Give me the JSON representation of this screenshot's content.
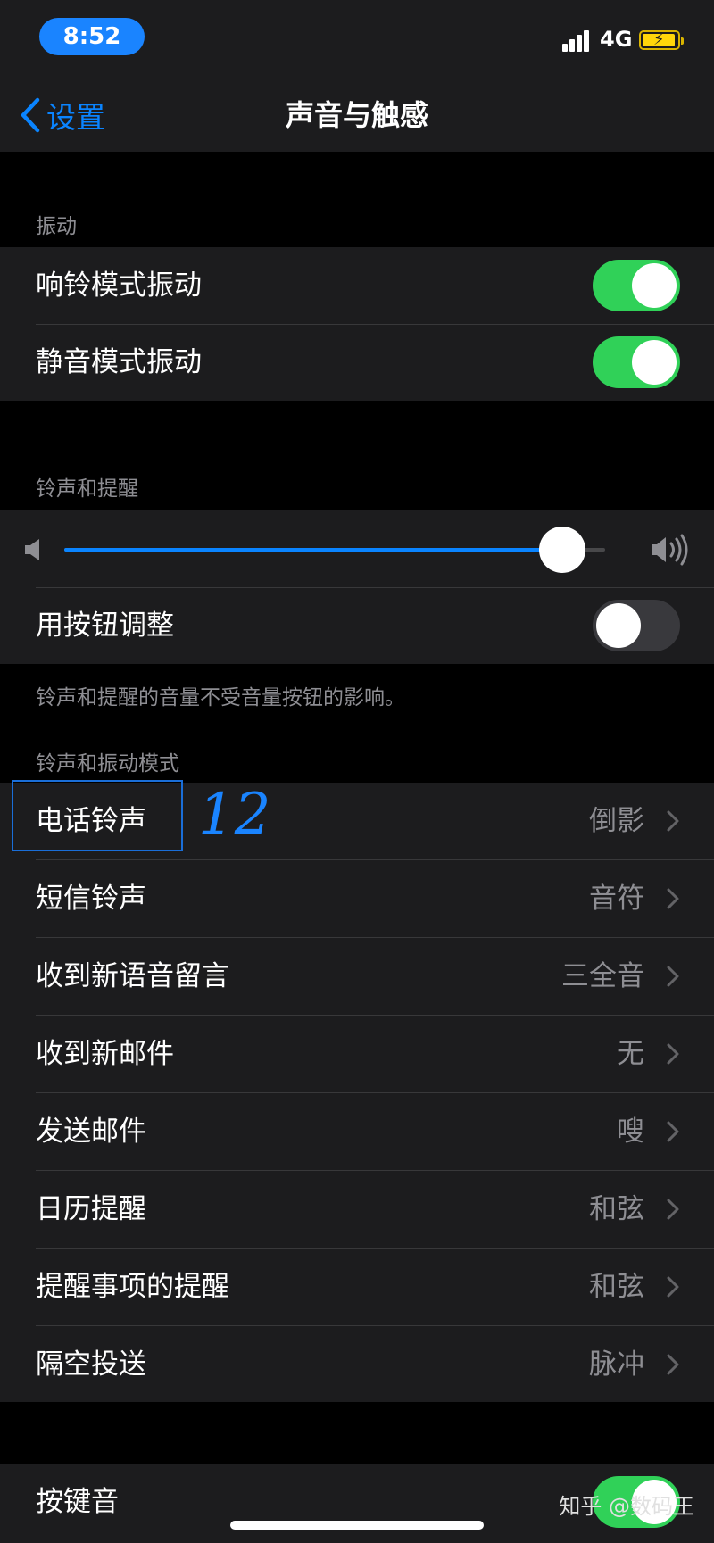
{
  "status_bar": {
    "time": "8:52",
    "network": "4G"
  },
  "nav": {
    "back_label": "设置",
    "title": "声音与触感"
  },
  "vibration": {
    "header": "振动",
    "ring_vibrate": {
      "label": "响铃模式振动",
      "on": true
    },
    "silent_vibrate": {
      "label": "静音模式振动",
      "on": true
    }
  },
  "ringer": {
    "header": "铃声和提醒",
    "volume_level": 0.92,
    "change_with_buttons": {
      "label": "用按钮调整",
      "on": false
    },
    "footer": "铃声和提醒的音量不受音量按钮的影响。"
  },
  "patterns": {
    "header": "铃声和振动模式",
    "items": [
      {
        "label": "电话铃声",
        "value": "倒影"
      },
      {
        "label": "短信铃声",
        "value": "音符"
      },
      {
        "label": "收到新语音留言",
        "value": "三全音"
      },
      {
        "label": "收到新邮件",
        "value": "无"
      },
      {
        "label": "发送邮件",
        "value": "嗖"
      },
      {
        "label": "日历提醒",
        "value": "和弦"
      },
      {
        "label": "提醒事项的提醒",
        "value": "和弦"
      },
      {
        "label": "隔空投送",
        "value": "脉冲"
      }
    ]
  },
  "keyboard_clicks": {
    "label": "按键音",
    "on": true
  },
  "annotation": "12",
  "watermark": "知乎 @数码王",
  "colors": {
    "accent": "#0a84ff",
    "toggle_on": "#30d158",
    "cell_bg": "#1c1c1e"
  }
}
